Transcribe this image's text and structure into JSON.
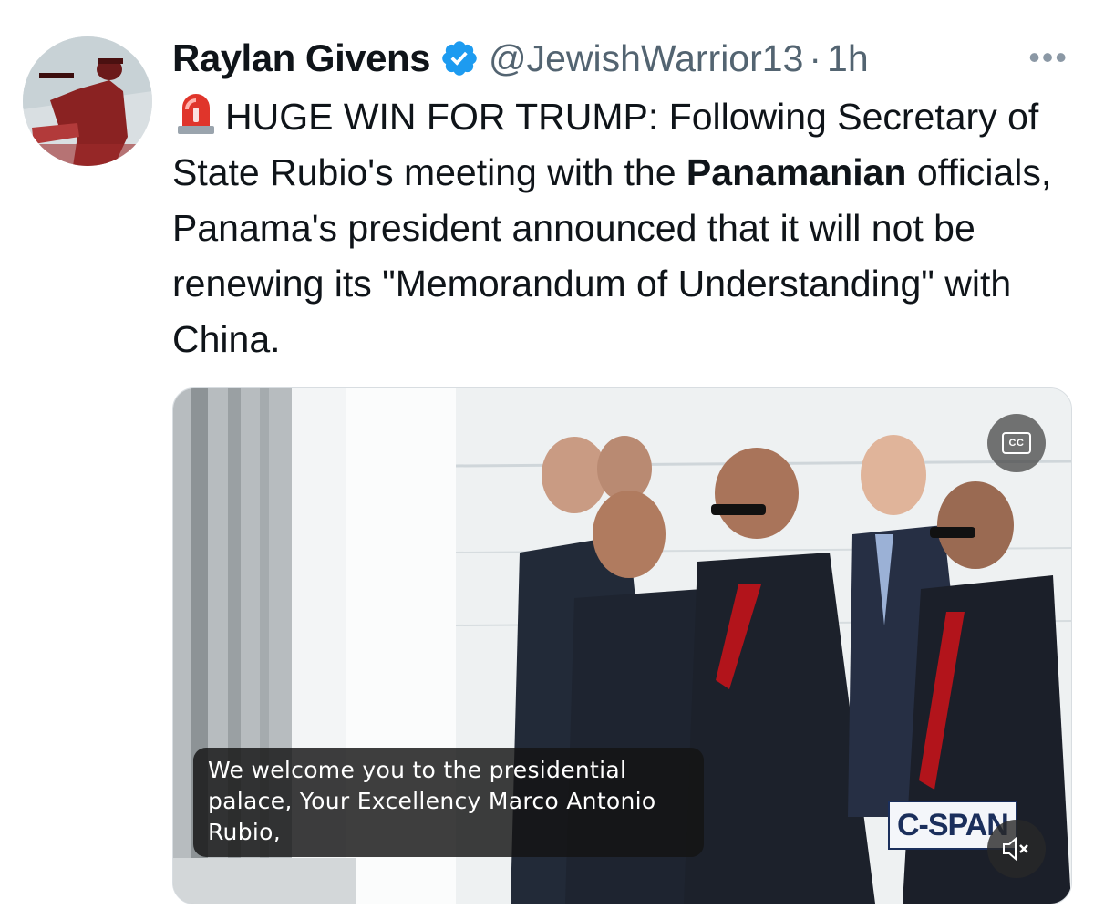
{
  "author": {
    "display_name": "Raylan Givens",
    "handle": "@JewishWarrior13",
    "separator": "·",
    "time": "1h",
    "verified": true
  },
  "more_label": "•••",
  "tweet": {
    "emoji": "siren-icon",
    "text_part1": "HUGE WIN FOR TRUMP: Following Secretary of State Rubio's meeting with the ",
    "text_bold": "Panamanian",
    "text_part2": " officials, Panama's president announced that it will not be renewing its \"Memorandum of Understanding\" with China."
  },
  "media": {
    "caption": "We welcome you to the presidential palace, Your Excellency Marco Antonio Rubio,",
    "cc_label": "CC",
    "watermark": "C-SPAN"
  },
  "colors": {
    "verified": "#1d9bf0",
    "text": "#0f1419",
    "muted": "#536471"
  }
}
